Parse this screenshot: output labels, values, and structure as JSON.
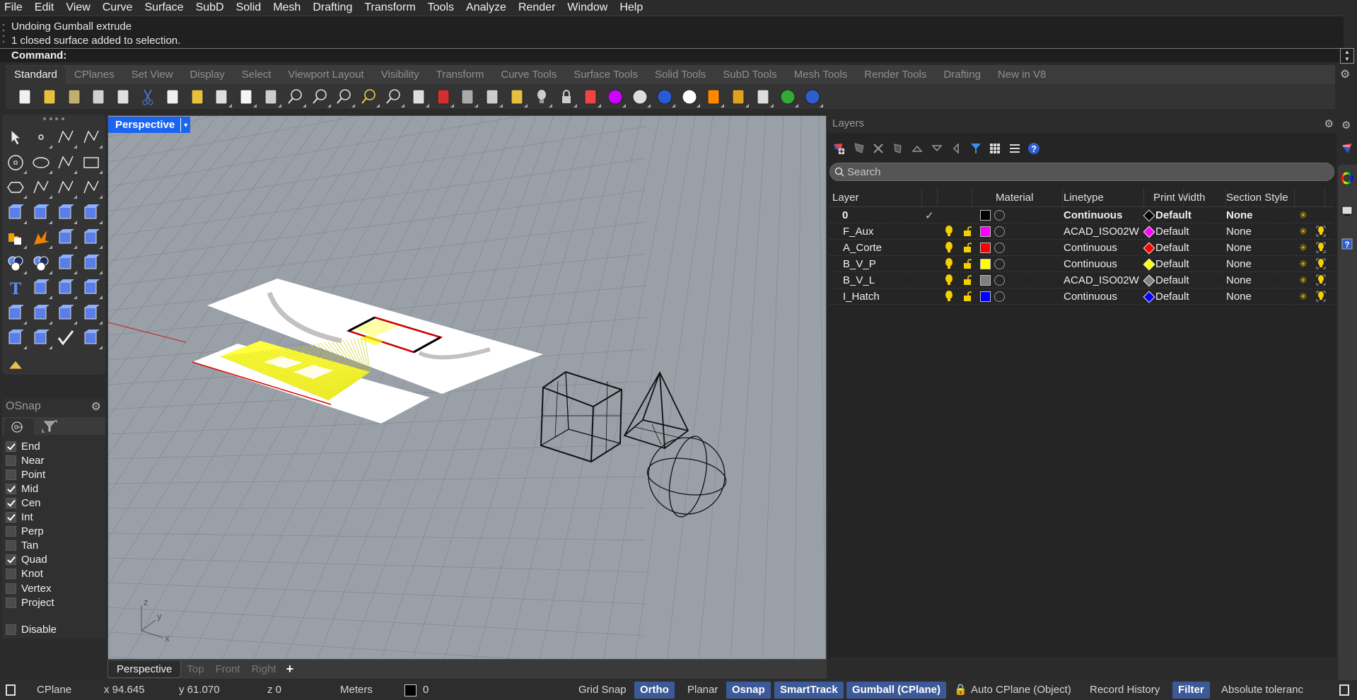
{
  "menu": [
    "File",
    "Edit",
    "View",
    "Curve",
    "Surface",
    "SubD",
    "Solid",
    "Mesh",
    "Drafting",
    "Transform",
    "Tools",
    "Analyze",
    "Render",
    "Window",
    "Help"
  ],
  "command": {
    "history": [
      "Undoing Gumball extrude",
      "1 closed surface added to selection."
    ],
    "prompt_label": "Command:",
    "input_value": ""
  },
  "toolbar_tabs": [
    {
      "label": "Standard",
      "active": true
    },
    {
      "label": "CPlanes"
    },
    {
      "label": "Set View"
    },
    {
      "label": "Display"
    },
    {
      "label": "Select"
    },
    {
      "label": "Viewport Layout"
    },
    {
      "label": "Visibility"
    },
    {
      "label": "Transform"
    },
    {
      "label": "Curve Tools"
    },
    {
      "label": "Surface Tools"
    },
    {
      "label": "Solid Tools"
    },
    {
      "label": "SubD Tools"
    },
    {
      "label": "Mesh Tools"
    },
    {
      "label": "Render Tools"
    },
    {
      "label": "Drafting"
    },
    {
      "label": "New in V8"
    }
  ],
  "toolbar_icons": [
    "new-file-icon",
    "open-folder-icon",
    "save-icon",
    "print-icon",
    "import-icon",
    "cut-icon",
    "copy-icon",
    "paste-icon",
    "undo-icon",
    "pan-hand-icon",
    "rotate-view-icon",
    "zoom-dynamic-icon",
    "zoom-window-icon",
    "zoom-extents-icon",
    "zoom-selected-icon",
    "undo-view-icon",
    "viewport-layout-icon",
    "car-display-icon",
    "cplane-icon",
    "osnap-point-icon",
    "gumball-icon",
    "light-bulb-icon",
    "lock-icon",
    "layer-icon",
    "color-wheel-icon",
    "sphere-display-icon",
    "rendered-sphere-icon",
    "material-sphere-icon",
    "spotlight-icon",
    "options-gear-icon",
    "dimension-icon",
    "rhino-green-icon",
    "help-icon"
  ],
  "toolbox_icons": [
    "select-arrow-icon",
    "point-icon",
    "polyline-icon",
    "curve-icon",
    "circle-icon",
    "ellipse-icon",
    "arc-icon",
    "rectangle-icon",
    "polygon-icon",
    "fillet-curve-icon",
    "surface-from-points-icon",
    "extrude-surface-icon",
    "box-solid-icon",
    "sphere-union-icon",
    "cylinder-icon",
    "mesh-surface-icon",
    "join-puzzle-icon",
    "explode-icon",
    "trim-icon",
    "split-icon",
    "boolean-union-icon",
    "boolean-group-icon",
    "offset-curve-icon",
    "offset-arc-icon",
    "text-icon",
    "move-icon",
    "array-icon",
    "mirror-icon",
    "solid-edit-icon",
    "extrude-arrows-icon",
    "grid-array-icon",
    "section-icon",
    "extrude-face-icon",
    "dimension-figure-icon",
    "check-icon",
    "solid-primitives-icon",
    "pyramid-tool-icon"
  ],
  "osnap": {
    "title": "OSnap",
    "items": [
      {
        "label": "End",
        "checked": true
      },
      {
        "label": "Near",
        "checked": false
      },
      {
        "label": "Point",
        "checked": false
      },
      {
        "label": "Mid",
        "checked": true
      },
      {
        "label": "Cen",
        "checked": true
      },
      {
        "label": "Int",
        "checked": true
      },
      {
        "label": "Perp",
        "checked": false
      },
      {
        "label": "Tan",
        "checked": false
      },
      {
        "label": "Quad",
        "checked": true
      },
      {
        "label": "Knot",
        "checked": false
      },
      {
        "label": "Vertex",
        "checked": false
      },
      {
        "label": "Project",
        "checked": false
      }
    ],
    "disable": {
      "label": "Disable",
      "checked": false
    }
  },
  "viewport": {
    "label": "Perspective",
    "axis": {
      "x": "x",
      "y": "y",
      "z": "z"
    },
    "tabs": [
      {
        "label": "Perspective",
        "active": true
      },
      {
        "label": "Top"
      },
      {
        "label": "Front"
      },
      {
        "label": "Right"
      }
    ],
    "add_tab": "+"
  },
  "layers": {
    "title": "Layers",
    "search_placeholder": "Search",
    "columns": [
      "Layer",
      "",
      "",
      "Material",
      "Linetype",
      "",
      "Print Width",
      "Section Style",
      ""
    ],
    "rows": [
      {
        "name": "0",
        "current": true,
        "color": "#000000",
        "linetype": "Continuous",
        "print_color": "#000000",
        "print_width": "Default",
        "section_style": "None",
        "bold": true
      },
      {
        "name": "F_Aux",
        "current": false,
        "color": "#ff00ff",
        "linetype": "ACAD_ISO02W",
        "print_color": "#ff00ff",
        "print_width": "Default",
        "section_style": "None"
      },
      {
        "name": "A_Corte",
        "current": false,
        "color": "#ff0000",
        "linetype": "Continuous",
        "print_color": "#ff0000",
        "print_width": "Default",
        "section_style": "None"
      },
      {
        "name": "B_V_P",
        "current": false,
        "color": "#ffff00",
        "linetype": "Continuous",
        "print_color": "#ffff00",
        "print_width": "Default",
        "section_style": "None"
      },
      {
        "name": "B_V_L",
        "current": false,
        "color": "#808080",
        "linetype": "ACAD_ISO02W",
        "print_color": "#808080",
        "print_width": "Default",
        "section_style": "None"
      },
      {
        "name": "I_Hatch",
        "current": false,
        "color": "#0000ff",
        "linetype": "Continuous",
        "print_color": "#0000ff",
        "print_width": "Default",
        "section_style": "None"
      }
    ]
  },
  "status": {
    "cplane": "CPlane",
    "x": "x 94.645",
    "y": "y 61.070",
    "z": "z 0",
    "units": "Meters",
    "layer": "0",
    "grid_snap": "Grid Snap",
    "ortho": "Ortho",
    "planar": "Planar",
    "osnap": "Osnap",
    "smarttrack": "SmartTrack",
    "gumball": "Gumball (CPlane)",
    "auto_cplane": "Auto CPlane (Object)",
    "record_history": "Record History",
    "filter": "Filter",
    "tolerance": "Absolute toleranc"
  },
  "colors": {
    "accent": "#1a64f0",
    "status_on": "#3d5a98",
    "viewport_bg": "#9aa0a8"
  }
}
